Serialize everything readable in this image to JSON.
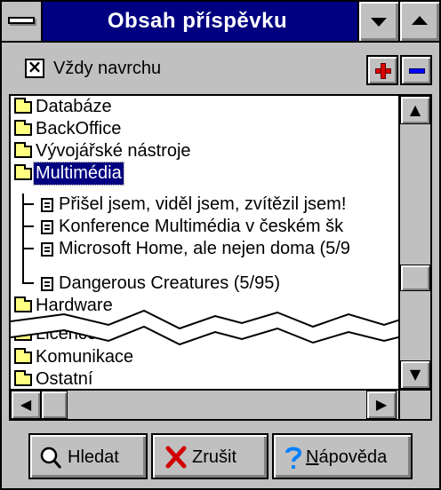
{
  "window": {
    "title": "Obsah příspěvku"
  },
  "options": {
    "always_on_top_label": "Vždy navrchu",
    "always_on_top_checked": true,
    "always_on_top_mark": "×"
  },
  "tree": {
    "folders_top": [
      {
        "label": "Databáze"
      },
      {
        "label": "BackOffice"
      },
      {
        "label": "Vývojářské nástroje"
      }
    ],
    "selected_folder": {
      "label": "Multimédia"
    },
    "documents": [
      {
        "label": "Přišel jsem, viděl jsem, zvítězil jsem!"
      },
      {
        "label": "Konference Multimédia v českém šk"
      },
      {
        "label": "Microsoft Home, ale nejen doma (5/9"
      },
      {
        "label": "Dangerous Creatures (5/95)"
      }
    ],
    "folders_bottom": [
      {
        "label": "Hardware"
      },
      {
        "label": "Licence"
      },
      {
        "label": "Komunikace"
      },
      {
        "label": "Ostatní"
      }
    ]
  },
  "buttons": {
    "search": "Hledat",
    "cancel": "Zrušit",
    "help_first": "N",
    "help_rest": "ápověda"
  },
  "colors": {
    "titlebar": "#000080",
    "selection": "#000080",
    "folder": "#ffff80",
    "plus_red": "#e00000",
    "minus_blue": "#0000ff",
    "help_icon": "#0080ff"
  },
  "icons": {
    "system_menu": "system-menu-icon",
    "minimize": "minimize-icon",
    "maximize": "maximize-icon",
    "expand": "plus-icon",
    "collapse": "minus-icon",
    "folder": "folder-icon",
    "document": "document-icon",
    "search": "magnifier-icon",
    "cancel": "x-icon",
    "help": "question-icon"
  }
}
